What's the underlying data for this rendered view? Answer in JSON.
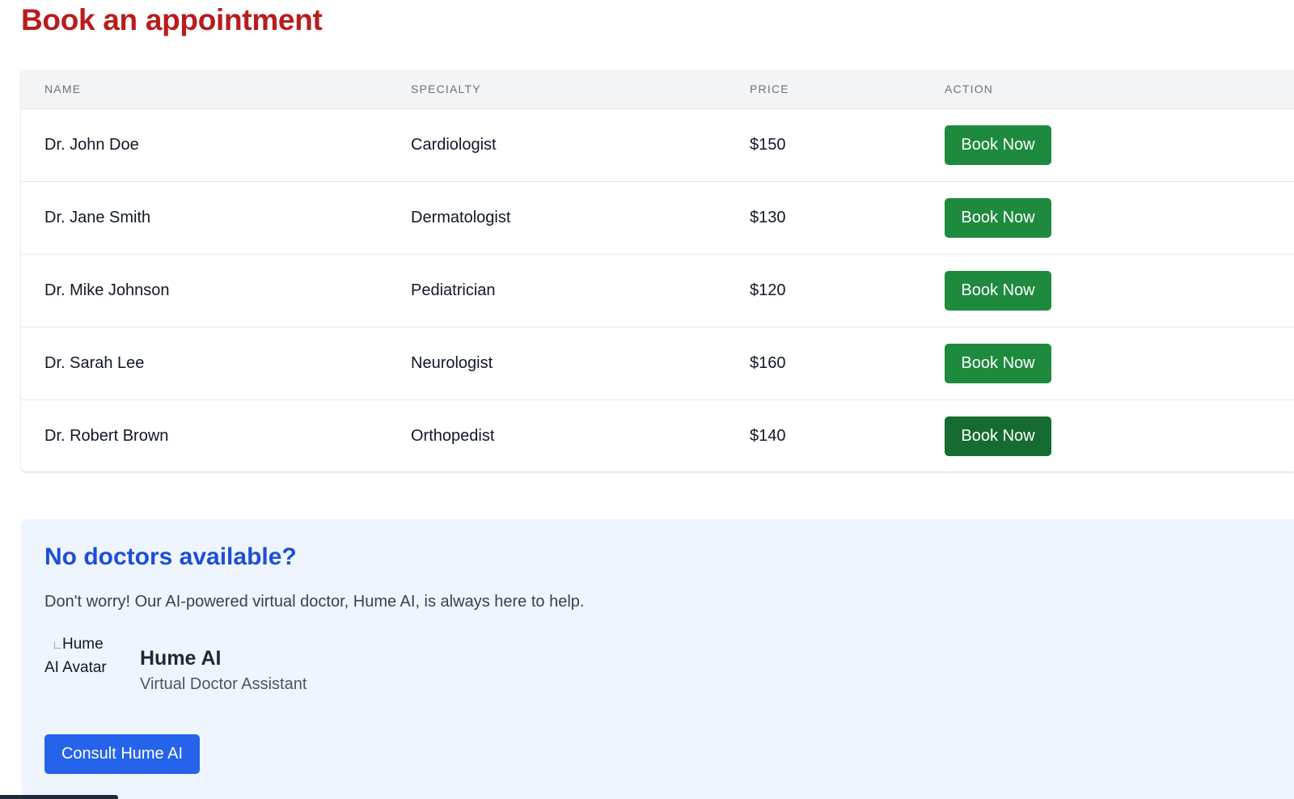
{
  "page": {
    "title": "Book an appointment"
  },
  "table": {
    "headers": {
      "name": "NAME",
      "specialty": "SPECIALTY",
      "price": "PRICE",
      "action": "ACTION"
    },
    "rows": [
      {
        "name": "Dr. John Doe",
        "specialty": "Cardiologist",
        "price": "$150",
        "action": "Book Now"
      },
      {
        "name": "Dr. Jane Smith",
        "specialty": "Dermatologist",
        "price": "$130",
        "action": "Book Now"
      },
      {
        "name": "Dr. Mike Johnson",
        "specialty": "Pediatrician",
        "price": "$120",
        "action": "Book Now"
      },
      {
        "name": "Dr. Sarah Lee",
        "specialty": "Neurologist",
        "price": "$160",
        "action": "Book Now"
      },
      {
        "name": "Dr. Robert Brown",
        "specialty": "Orthopedist",
        "price": "$140",
        "action": "Book Now"
      }
    ]
  },
  "ai_section": {
    "title": "No doctors available?",
    "text": "Don't worry! Our AI-powered virtual doctor, Hume AI, is always here to help.",
    "avatar_alt": "Hume AI Avatar",
    "name": "Hume AI",
    "subtitle": "Virtual Doctor Assistant",
    "button_label": "Consult Hume AI"
  },
  "colors": {
    "title": "#b91c1c",
    "book_button": "#1e8a3e",
    "book_button_hover": "#166b31",
    "ai_title": "#1d4ed8",
    "ai_background": "#eef5ff",
    "consult_button": "#2563eb"
  },
  "icons": {
    "avatar_image": "broken-image-icon"
  }
}
